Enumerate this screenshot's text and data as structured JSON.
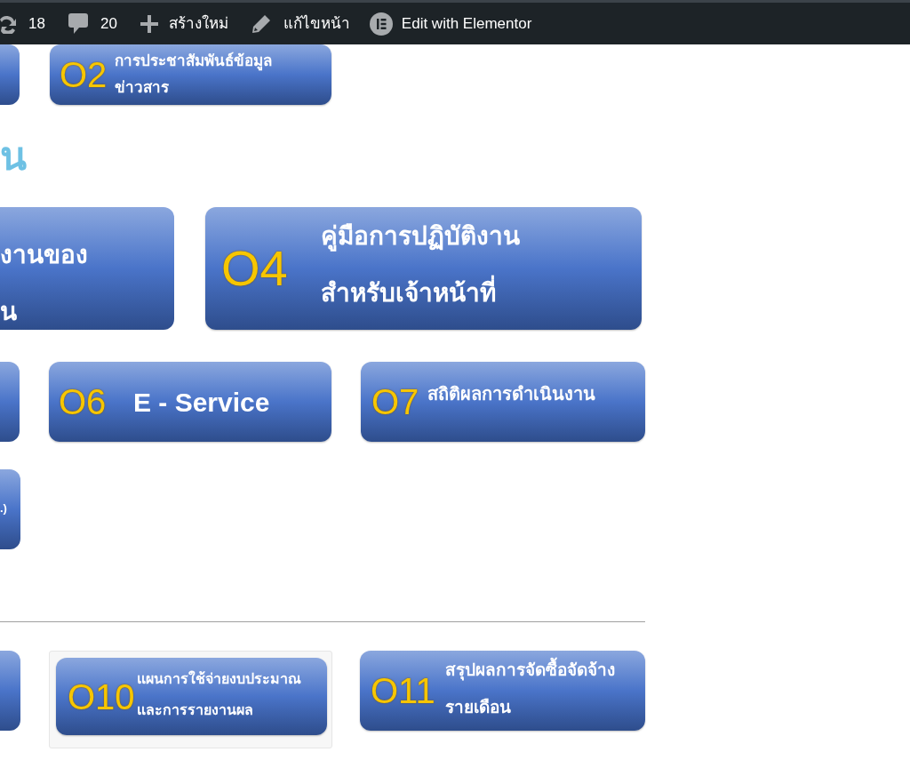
{
  "admin_bar": {
    "items": [
      {
        "kind": "updates",
        "label": "18"
      },
      {
        "kind": "comments",
        "label": "20"
      },
      {
        "kind": "new",
        "label": "สร้างใหม่"
      },
      {
        "kind": "edit",
        "label": "แก้ไขหน้า"
      },
      {
        "kind": "elementor",
        "label": "Edit with Elementor"
      }
    ]
  },
  "content": [
    {
      "kind": "cards",
      "cards": [
        {
          "kind": "partial"
        },
        {
          "kind": "full",
          "number": "O2",
          "title": "การประชาสัมพันธ์ข้อมูล\nข่าวสาร"
        }
      ]
    },
    {
      "kind": "heading",
      "text": "น"
    },
    {
      "kind": "cards",
      "cards": [
        {
          "kind": "partial",
          "title": "งานของ\nน"
        },
        {
          "kind": "full",
          "number": "O4",
          "title": "คู่มือการปฏิบัติงาน\nสำหรับเจ้าหน้าที่"
        }
      ]
    },
    {
      "kind": "cards",
      "cards": [
        {
          "kind": "partial"
        },
        {
          "kind": "full",
          "number": "O6",
          "title": "E - Service"
        },
        {
          "kind": "full",
          "number": "O7",
          "title": "สถิติผลการดำเนินงาน"
        }
      ]
    },
    {
      "kind": "cards",
      "cards": [
        {
          "kind": "partial",
          "title": ".)"
        }
      ]
    },
    {
      "kind": "divider"
    },
    {
      "kind": "cards",
      "cards": [
        {
          "kind": "partial"
        },
        {
          "kind": "full",
          "number": "O10",
          "title": "แผนการใช้จ่ายงบประมาณ\nและการรายงานผล",
          "framed": true
        },
        {
          "kind": "full",
          "number": "O11",
          "title": "สรุปผลการจัดซื้อจัดจ้าง\nรายเดือน"
        }
      ]
    }
  ]
}
